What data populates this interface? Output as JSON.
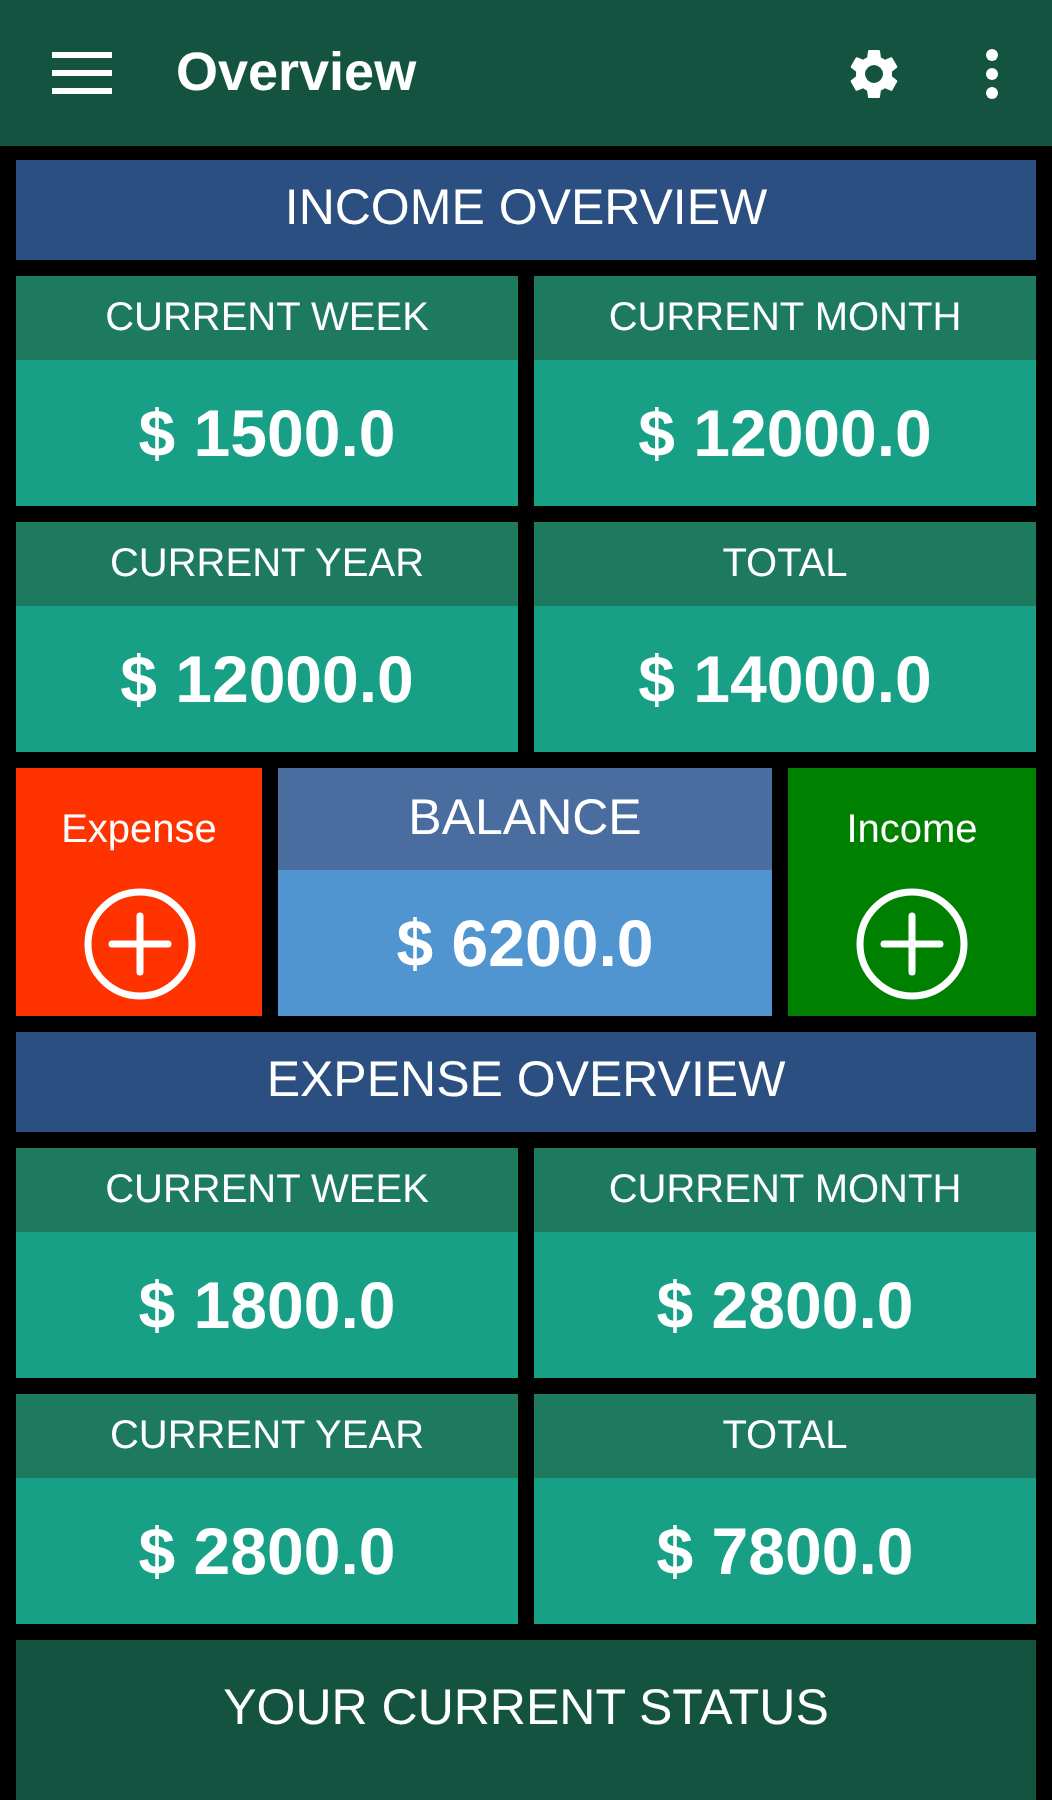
{
  "app_bar": {
    "title": "Overview"
  },
  "income_overview": {
    "title": "INCOME OVERVIEW",
    "cards": [
      {
        "label": "CURRENT WEEK",
        "value": "$ 1500.0"
      },
      {
        "label": "CURRENT MONTH",
        "value": "$ 12000.0"
      },
      {
        "label": "CURRENT YEAR",
        "value": "$ 12000.0"
      },
      {
        "label": "TOTAL",
        "value": "$ 14000.0"
      }
    ]
  },
  "actions": {
    "expense": {
      "label": "Expense",
      "color": "#ff3300"
    },
    "balance": {
      "label": "BALANCE",
      "value": "$ 6200.0"
    },
    "income": {
      "label": "Income",
      "color": "#008000"
    }
  },
  "expense_overview": {
    "title": "EXPENSE OVERVIEW",
    "cards": [
      {
        "label": "CURRENT WEEK",
        "value": "$ 1800.0"
      },
      {
        "label": "CURRENT MONTH",
        "value": "$ 2800.0"
      },
      {
        "label": "CURRENT YEAR",
        "value": "$ 2800.0"
      },
      {
        "label": "TOTAL",
        "value": "$ 7800.0"
      }
    ]
  },
  "status": {
    "title": "YOUR CURRENT STATUS"
  }
}
